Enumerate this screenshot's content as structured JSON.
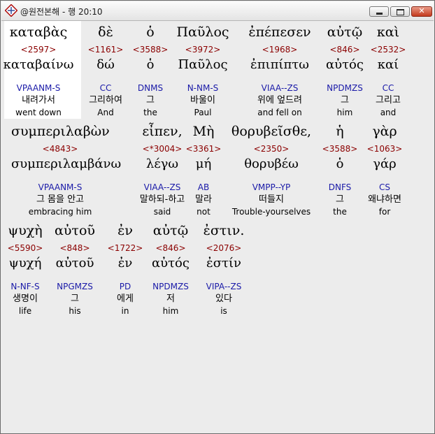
{
  "window": {
    "title": "@원전본해 - 행 20:10",
    "icon": "bible-app-icon"
  },
  "controls": {
    "minimize": "minimize-icon",
    "maximize": "maximize-icon",
    "close": "close-icon"
  },
  "rows": [
    {
      "words": [
        {
          "greek": "καταβὰς",
          "strongs": "<2597>",
          "lemma": "καταβαίνω",
          "morph": "VPAANM-S",
          "korean": "내려가서",
          "english": "went down"
        },
        {
          "greek": "δὲ",
          "strongs": "<1161>",
          "lemma": "δώ",
          "morph": "CC",
          "korean": "그리하여",
          "english": "And"
        },
        {
          "greek": "ὁ",
          "strongs": "<3588>",
          "lemma": "ὁ",
          "morph": "DNMS",
          "korean": "그",
          "english": "the"
        },
        {
          "greek": "Παῦλος",
          "strongs": "<3972>",
          "lemma": "Παῦλος",
          "morph": "N-NM-S",
          "korean": "바울이",
          "english": "Paul"
        },
        {
          "greek": "ἐπέπεσεν",
          "strongs": "<1968>",
          "lemma": "ἐπιπίπτω",
          "morph": "VIAA--ZS",
          "korean": "위에 엎드려",
          "english": "and fell on"
        },
        {
          "greek": "αὐτῷ",
          "strongs": "<846>",
          "lemma": "αὐτός",
          "morph": "NPDMZS",
          "korean": "그",
          "english": "him"
        },
        {
          "greek": "καὶ",
          "strongs": "<2532>",
          "lemma": "καί",
          "morph": "CC",
          "korean": "그리고",
          "english": "and"
        }
      ]
    },
    {
      "words": [
        {
          "greek": "συμπεριλαβὼν",
          "strongs": "<4843>",
          "lemma": "συμπεριλαμβάνω",
          "morph": "VPAANM-S",
          "korean": "그 몸을 안고",
          "english": "embracing him"
        },
        {
          "greek": "εἶπεν,",
          "strongs": "<*3004>",
          "lemma": "λέγω",
          "morph": "VIAA--ZS",
          "korean": "말하되-하고",
          "english": "said"
        },
        {
          "greek": "Μὴ",
          "strongs": "<3361>",
          "lemma": "μή",
          "morph": "AB",
          "korean": "말라",
          "english": "not"
        },
        {
          "greek": "θορυβεῖσθε,",
          "strongs": "<2350>",
          "lemma": "θορυβέω",
          "morph": "VMPP--YP",
          "korean": "떠들지",
          "english": "Trouble-yourselves"
        },
        {
          "greek": "ἡ",
          "strongs": "<3588>",
          "lemma": "ὁ",
          "morph": "DNFS",
          "korean": "그",
          "english": "the"
        },
        {
          "greek": "γὰρ",
          "strongs": "<1063>",
          "lemma": "γάρ",
          "morph": "CS",
          "korean": "왜냐하면",
          "english": "for"
        }
      ]
    },
    {
      "words": [
        {
          "greek": "ψυχὴ",
          "strongs": "<5590>",
          "lemma": "ψυχή",
          "morph": "N-NF-S",
          "korean": "생명이",
          "english": "life"
        },
        {
          "greek": "αὐτοῦ",
          "strongs": "<848>",
          "lemma": "αὐτοῦ",
          "morph": "NPGMZS",
          "korean": "그",
          "english": "his"
        },
        {
          "greek": "ἐν",
          "strongs": "<1722>",
          "lemma": "ἐν",
          "morph": "PD",
          "korean": "에게",
          "english": "in"
        },
        {
          "greek": "αὐτῷ",
          "strongs": "<846>",
          "lemma": "αὐτός",
          "morph": "NPDMZS",
          "korean": "저",
          "english": "him"
        },
        {
          "greek": "ἐστιν.",
          "strongs": "<2076>",
          "lemma": "ἐστίν",
          "morph": "VIPA--ZS",
          "korean": "있다",
          "english": "is"
        }
      ]
    }
  ],
  "colors": {
    "strongs": "#8b0000",
    "morph": "#1a1aa8",
    "background": "#ececec",
    "highlight": "#ffffff"
  }
}
